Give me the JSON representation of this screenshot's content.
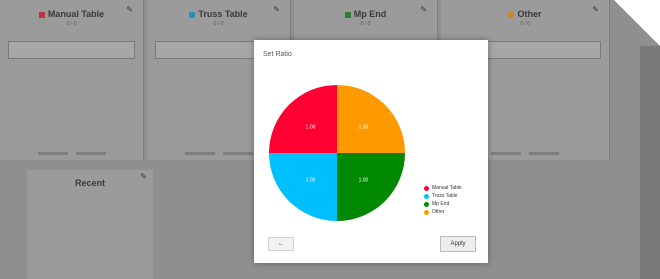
{
  "background_columns": [
    {
      "title": "Manual Table",
      "color": "#ff0040",
      "subtitle": "0 / 0"
    },
    {
      "title": "Truss Table",
      "color": "#00bfff",
      "subtitle": "0 / 0"
    },
    {
      "title": "Mp End",
      "color": "#008000",
      "subtitle": "0 / 0"
    },
    {
      "title": "Other",
      "color": "#ff9900",
      "subtitle": "0 / 0"
    }
  ],
  "lower_panel": {
    "title": "Recent"
  },
  "dialog": {
    "title": "Set Ratio",
    "cancel_label": "←",
    "ok_label": "Apply"
  },
  "chart_data": {
    "type": "pie",
    "slices": [
      {
        "label": "Manual Table",
        "value": 25,
        "color": "#ff0033",
        "data_label": "1.00"
      },
      {
        "label": "Truss Table",
        "value": 25,
        "color": "#00bfff",
        "data_label": "1.00"
      },
      {
        "label": "Mp End",
        "value": 25,
        "color": "#008800",
        "data_label": "1.00"
      },
      {
        "label": "Other",
        "value": 25,
        "color": "#ff9900",
        "data_label": "1.00"
      }
    ],
    "legend_position": "bottom-right"
  }
}
